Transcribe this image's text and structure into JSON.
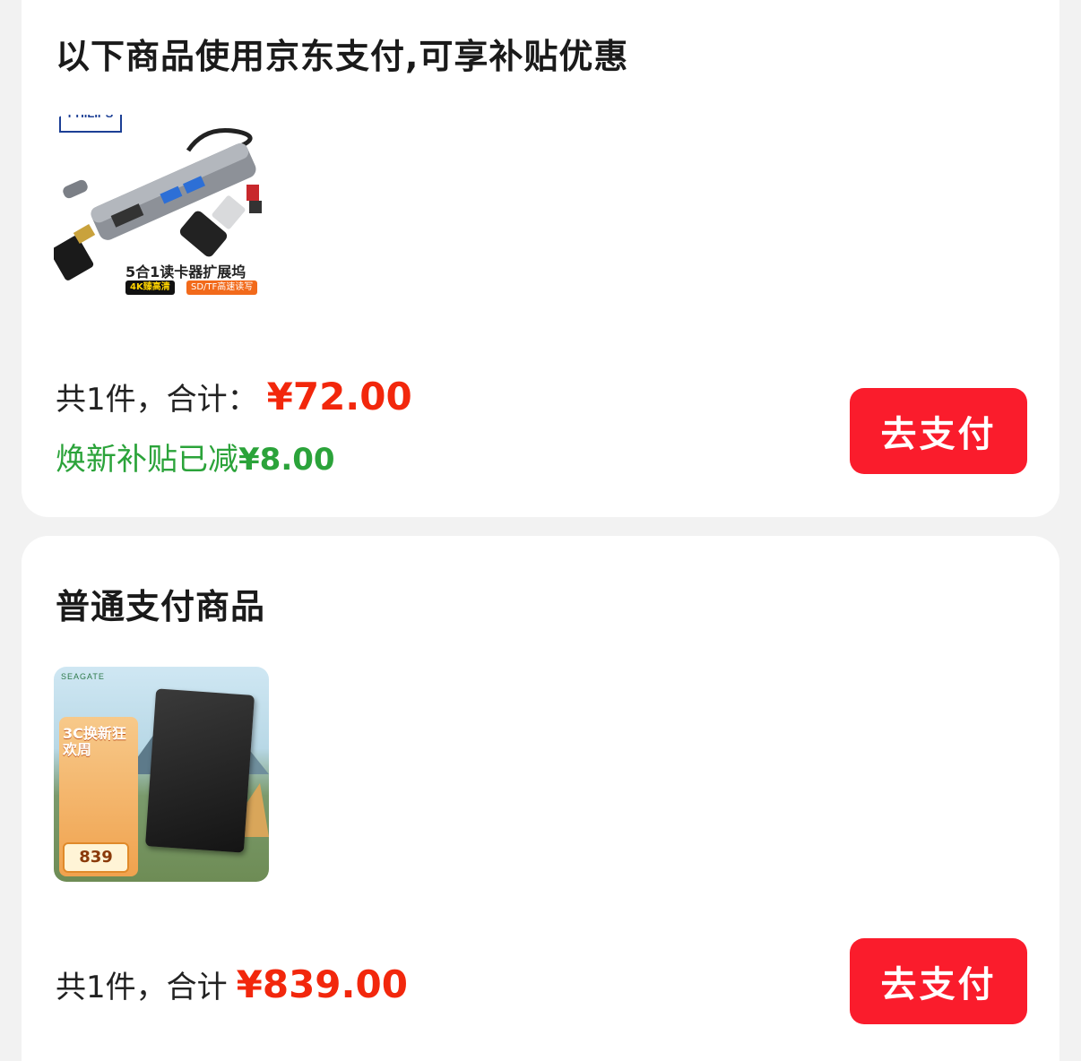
{
  "subsidy_section": {
    "title": "以下商品使用京东支付,可享补贴优惠",
    "product": {
      "brand_badge": "PHILIPS",
      "image_caption": "5合1读卡器扩展坞",
      "image_tags": [
        "4K臻高清",
        "SD/TF高速读写"
      ]
    },
    "summary_label": "共1件，合计：",
    "total_price": "¥72.00",
    "subsidy_label": "焕新补贴已减",
    "subsidy_amount": "¥8.00",
    "pay_button": "去支付"
  },
  "normal_section": {
    "title": "普通支付商品",
    "product": {
      "brand": "SEAGATE",
      "promo_title": "3C换新狂欢周",
      "promo_price": "839"
    },
    "summary_label": "共1件，合计",
    "total_price": "¥839.00",
    "pay_button": "去支付"
  },
  "colors": {
    "price_red": "#f2270c",
    "button_red": "#fa1c2c",
    "subsidy_green": "#2ba33a"
  }
}
